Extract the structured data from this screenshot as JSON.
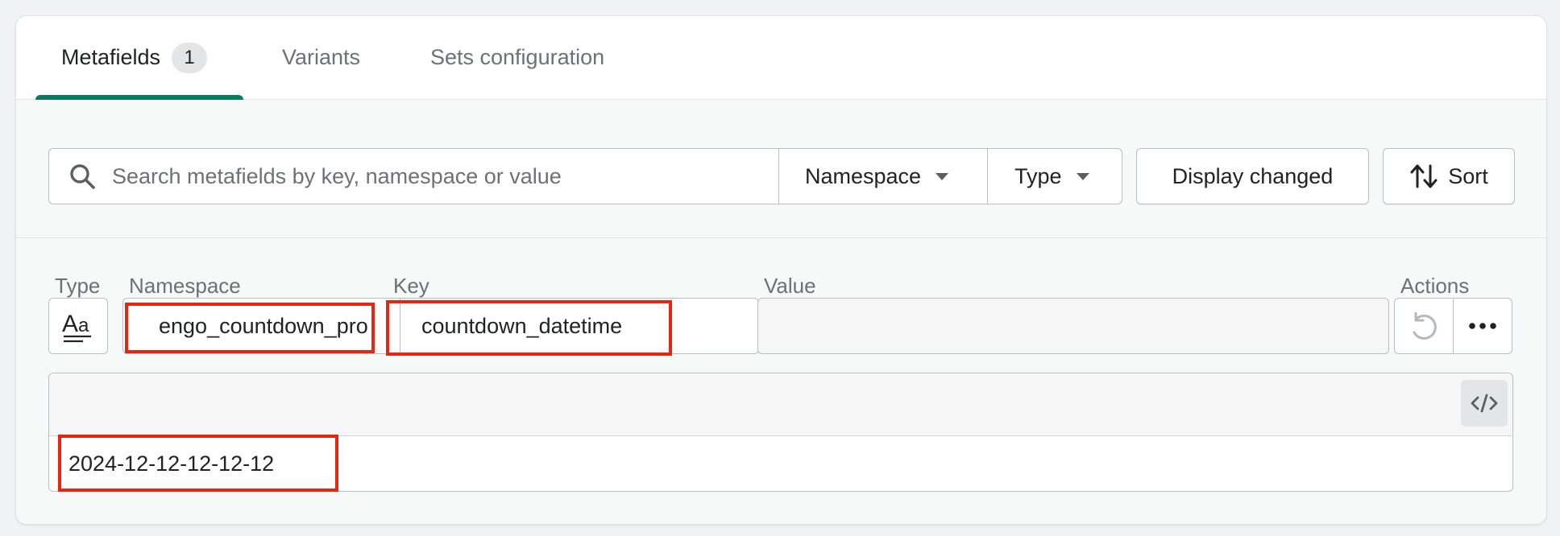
{
  "tabs": [
    {
      "label": "Metafields",
      "badge": "1",
      "active": true
    },
    {
      "label": "Variants",
      "active": false
    },
    {
      "label": "Sets configuration",
      "active": false
    }
  ],
  "toolbar": {
    "search_placeholder": "Search metafields by key, namespace or value",
    "namespace_label": "Namespace",
    "type_label": "Type",
    "display_changed_label": "Display changed",
    "sort_label": "Sort"
  },
  "columns": {
    "type": "Type",
    "namespace": "Namespace",
    "key": "Key",
    "value": "Value",
    "actions": "Actions"
  },
  "row": {
    "type_icon": "text-type-icon",
    "namespace": "engo_countdown_pro",
    "key": "countdown_datetime",
    "value": "",
    "editor_value": "2024-12-12-12-12-12"
  },
  "colors": {
    "accent": "#0b7a5a",
    "highlight": "#e8260f"
  }
}
